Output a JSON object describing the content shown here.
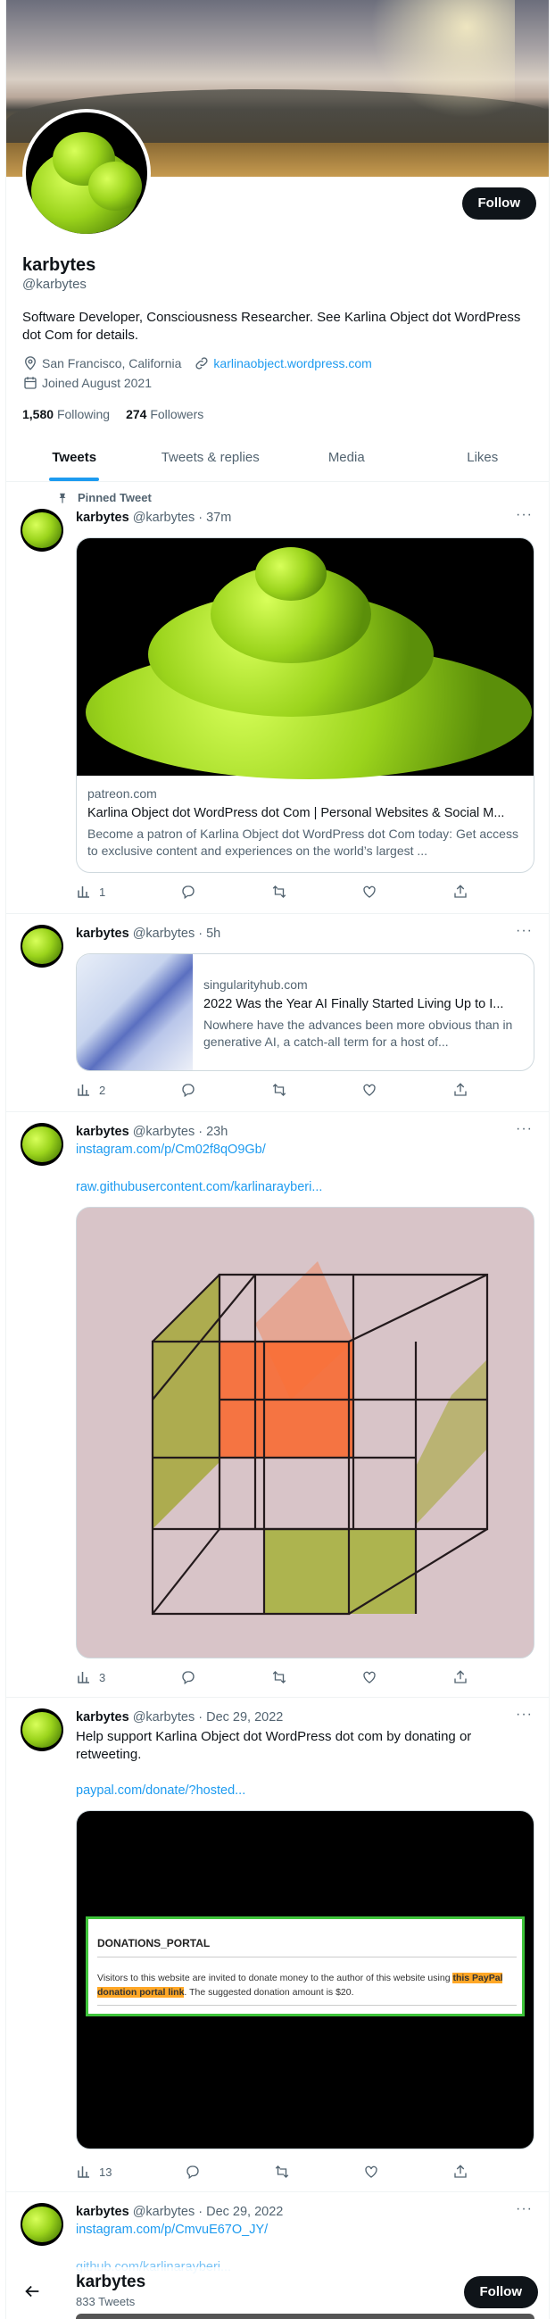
{
  "profile": {
    "name": "karbytes",
    "handle": "@karbytes",
    "bio": "Software Developer, Consciousness Researcher. See Karlina Object dot WordPress dot Com for details.",
    "location": "San Francisco, California",
    "website": "karlinaobject.wordpress.com",
    "joined": "Joined August 2021",
    "following_count": "1,580",
    "following_label": "Following",
    "followers_count": "274",
    "followers_label": "Followers",
    "follow_label": "Follow"
  },
  "tabs": [
    "Tweets",
    "Tweets & replies",
    "Media",
    "Likes"
  ],
  "pinned_label": "Pinned Tweet",
  "tweets": [
    {
      "name": "karbytes",
      "meta": "@karbytes · 37m",
      "card": {
        "domain": "patreon.com",
        "title": "Karlina Object dot WordPress dot Com | Personal Websites & Social M...",
        "desc": "Become a patron of Karlina Object dot WordPress dot Com today: Get access to exclusive content and experiences on the world’s largest ..."
      },
      "views": "1"
    },
    {
      "name": "karbytes",
      "meta": "@karbytes · 5h",
      "card": {
        "domain": "singularityhub.com",
        "title": "2022 Was the Year AI Finally Started Living Up to I...",
        "desc": "Nowhere have the advances been more obvious than in generative AI, a catch-all term for a host of..."
      },
      "views": "2"
    },
    {
      "name": "karbytes",
      "meta": "@karbytes · 23h",
      "link1": "instagram.com/p/Cm02f8qO9Gb/",
      "link2": "raw.githubusercontent.com/karlinarayberi...",
      "views": "3"
    },
    {
      "name": "karbytes",
      "meta": "@karbytes · Dec 29, 2022",
      "text": "Help support Karlina Object dot WordPress dot com by donating or retweeting.",
      "link1": "paypal.com/donate/?hosted...",
      "portal": {
        "title": "DONATIONS_PORTAL",
        "text_before": "Visitors to this website are invited to donate money to the author of this website using",
        "highlight": "this PayPal donation portal link",
        "text_after": ". The suggested donation amount is $20."
      },
      "views": "13"
    },
    {
      "name": "karbytes",
      "meta": "@karbytes · Dec 29, 2022",
      "link1": "instagram.com/p/CmvuE67O_JY/",
      "link2": "github.com/karlinarayberi..."
    }
  ],
  "bottom_bar": {
    "name": "karbytes",
    "tweet_count": "833 Tweets",
    "follow_label": "Follow"
  },
  "colors": {
    "accent": "#1d9bf0",
    "text": "#0f1419",
    "muted": "#536471",
    "border": "#cfd9de"
  }
}
